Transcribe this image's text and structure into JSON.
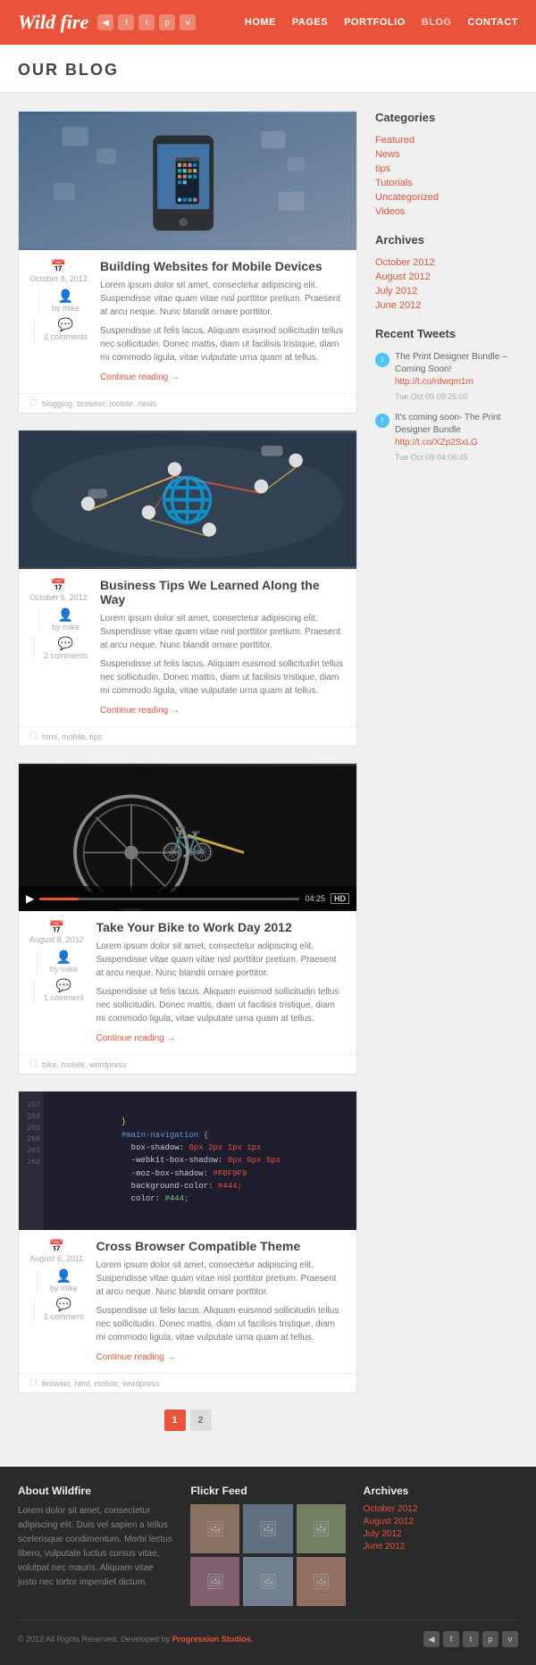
{
  "header": {
    "logo": "Wild fire",
    "nav": [
      "HOME",
      "PAGES",
      "PORTFOLIO",
      "BLOG",
      "CONTACT"
    ],
    "icons": [
      "rss",
      "facebook",
      "twitter",
      "pinterest",
      "vimeo"
    ]
  },
  "page_title": "OUR BLOG",
  "posts": [
    {
      "id": "post-1",
      "image_type": "mobile",
      "title": "Building Websites for Mobile Devices",
      "date": "October 8, 2012",
      "author": "by mike",
      "comments": "2 comments",
      "excerpt1": "Lorem ipsum dolor sit amet, consectetur adipiscing elit. Suspendisse vitae quam vitae nisl porttitor pretium. Praesent at arcu neque. Nunc blandit ornare porttitor.",
      "excerpt2": "Suspendisse ut felis lacus. Aliquam euismod sollicitudin tellus nec sollicitudin. Donec mattis, diam ut facilisis tristique, diam mi commodo ligula, vitae vulputate urna quam at tellus.",
      "continue": "Continue reading →",
      "tags": "blogging, browser, mobile, news"
    },
    {
      "id": "post-2",
      "image_type": "network",
      "title": "Business Tips We Learned Along the Way",
      "date": "October 6, 2012",
      "author": "by mike",
      "comments": "2 comments",
      "excerpt1": "Lorem ipsum dolor sit amet, consectetur adipiscing elit. Suspendisse vitae quam vitae nisl porttitor pretium. Praesent at arcu neque. Nunc blandit ornare porttitor.",
      "excerpt2": "Suspendisse ut felis lacus. Aliquam euismod sollicitudin tellus nec sollicitudin. Donec mattis, diam ut facilisis tristique, diam mi commodo ligula, vitae vulputate urna quam at tellus.",
      "continue": "Continue reading →",
      "tags": "html, mobile, tips"
    },
    {
      "id": "post-3",
      "image_type": "bike",
      "title": "Take Your Bike to Work Day 2012",
      "date": "August 8, 2012",
      "author": "by mike",
      "comments": "1 comment",
      "excerpt1": "Lorem ipsum dolor sit amet, consectetur adipiscing elit. Suspendisse vitae quam vitae nisl porttitor pretium. Praesent at arcu neque. Nunc blandit ornare porttitor.",
      "excerpt2": "Suspendisse ut felis lacus. Aliquam euismod sollicitudin tellus nec sollicitudin. Donec mattis, diam ut facilisis tristique, diam mi commodo ligula, vitae vulputate urna quam at tellus.",
      "continue": "Continue reading →",
      "tags": "bike, mobile, wordpress"
    },
    {
      "id": "post-4",
      "image_type": "code",
      "title": "Cross Browser Compatible Theme",
      "date": "August 6, 2011",
      "author": "by mike",
      "comments": "1 comment",
      "excerpt1": "Lorem ipsum dolor sit amet, consectetur adipiscing elit. Suspendisse vitae quam vitae nisl porttitor pretium. Praesent at arcu neque. Nunc blandit ornare porttitor.",
      "excerpt2": "Suspendisse ut felis lacus. Aliquam euismod sollicitudin tellus nec sollicitudin. Donec mattis, diam ut facilisis tristique, diam mi commodo ligula, vitae vulputate urna quam at tellus.",
      "continue": "Continue reading →",
      "tags": "browser, html, mobile, wordpress"
    }
  ],
  "sidebar": {
    "categories_title": "Categories",
    "categories": [
      "Featured",
      "News",
      "tips",
      "Tutorials",
      "Uncategorized",
      "Videos"
    ],
    "archives_title": "Archives",
    "archives": [
      "October 2012",
      "August 2012",
      "July 2012",
      "June 2012"
    ],
    "tweets_title": "Recent Tweets",
    "tweets": [
      {
        "text": "The Print Designer Bundle – Coming Soon!",
        "link": "http://t.co/rdwqm1m",
        "time": "Tue Oct 09 09:25:00"
      },
      {
        "text": "It's coming soon- The Print Designer Bundle",
        "link": "http://t.co/XZp2SxLG",
        "time": "Tue Oct 09 04:06:45"
      }
    ]
  },
  "pagination": {
    "pages": [
      "1",
      "2"
    ],
    "current": "1"
  },
  "footer": {
    "about_title": "About Wildfire",
    "about_text": "Lorem dolor sit amet, consectetur adipiscing elit. Duis vel sapien a tellus scelerisque condimentum. Morbi lectus libero, vulputate luctus cursus vitae, volutpat nec mauris. Aliquam vitae justo nec tortor imperdiet dictum.",
    "flickr_title": "Flickr Feed",
    "archives_title": "Archives",
    "footer_archives": [
      "October 2012",
      "August 2012",
      "July 2012",
      "June 2012"
    ],
    "copyright": "© 2012 All Rights Reserved. Developed by",
    "studio": "Progression Studios."
  }
}
